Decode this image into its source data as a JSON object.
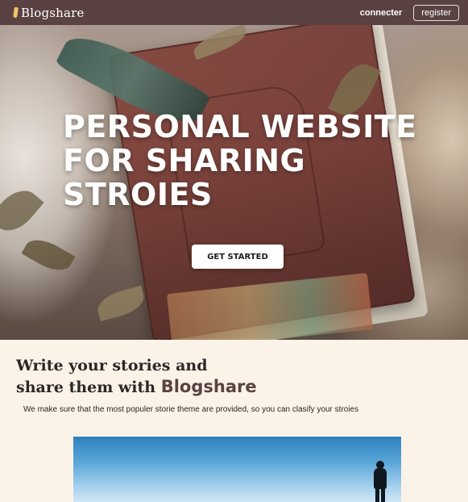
{
  "navbar": {
    "brand": "Blogshare",
    "brand_icon": "quill-icon",
    "login_label": "connecter",
    "register_label": "register",
    "background_color": "#5a4142"
  },
  "hero": {
    "title": "PERSONAL WEBSITE\nFOR SHARING\nSTROIES",
    "cta_label": "GET STARTED"
  },
  "content": {
    "heading_line1": "Write your stories and",
    "heading_line2_prefix": "share them with ",
    "heading_brand": "Blogshare",
    "description": "We make sure that the  most populer storie theme are provided, so you can clasify your stroies"
  },
  "colors": {
    "page_background": "#fbf3e8",
    "accent": "#5a4142",
    "button_background": "#ffffff"
  }
}
